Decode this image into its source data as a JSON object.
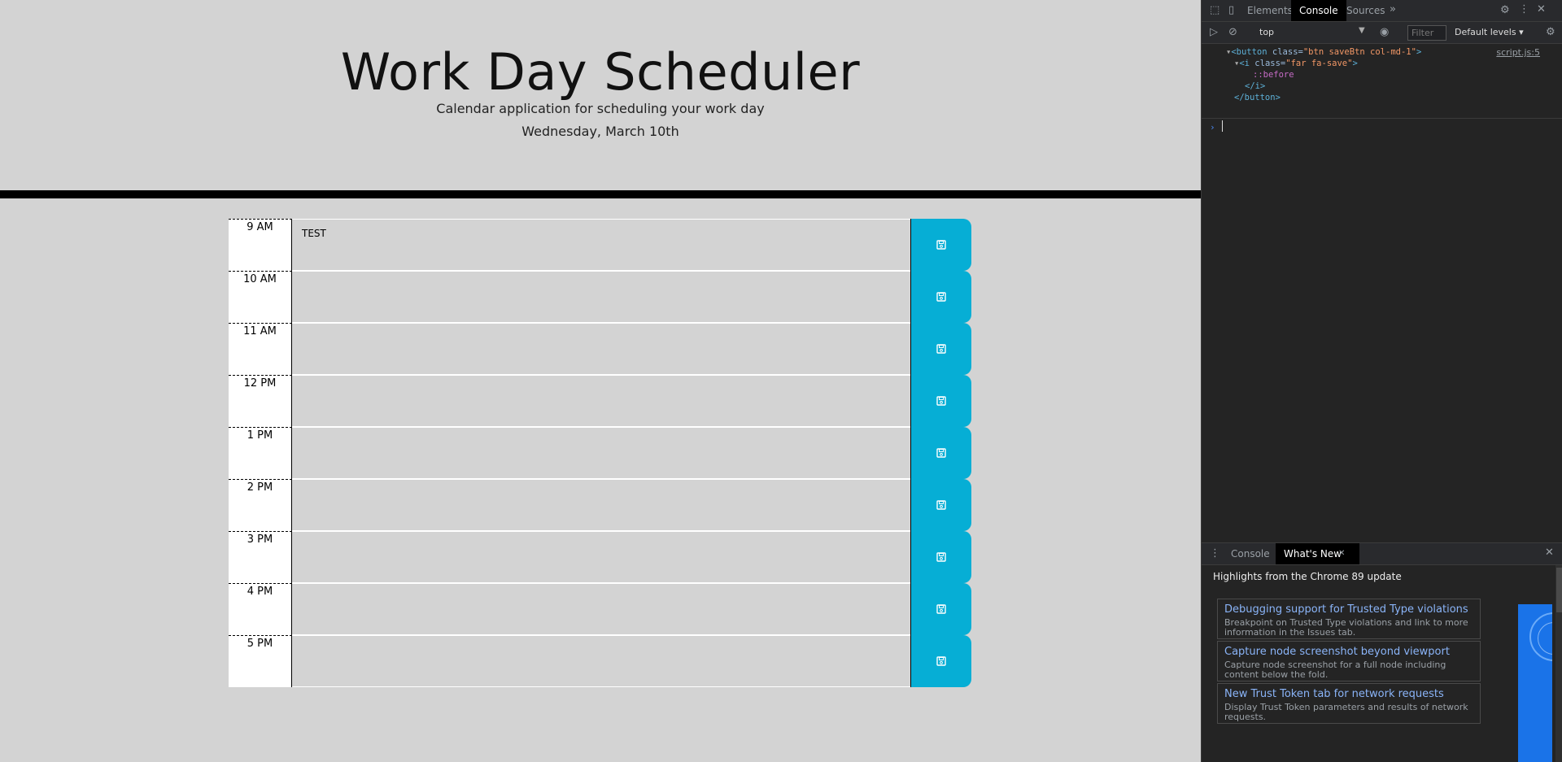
{
  "header": {
    "title": "Work Day Scheduler",
    "subtitle": "Calendar application for scheduling your work day",
    "date": "Wednesday, March 10th"
  },
  "schedule": {
    "rows": [
      {
        "hour": "9 AM",
        "text": "TEST"
      },
      {
        "hour": "10 AM",
        "text": ""
      },
      {
        "hour": "11 AM",
        "text": ""
      },
      {
        "hour": "12 PM",
        "text": ""
      },
      {
        "hour": "1 PM",
        "text": ""
      },
      {
        "hour": "2 PM",
        "text": ""
      },
      {
        "hour": "3 PM",
        "text": ""
      },
      {
        "hour": "4 PM",
        "text": ""
      },
      {
        "hour": "5 PM",
        "text": ""
      }
    ],
    "save_icon": "floppy-disk-icon"
  },
  "colors": {
    "page_bg": "#d3d3d3",
    "save_button": "#06aed5",
    "divider": "#000000",
    "hour_bg": "#ffffff"
  },
  "devtools": {
    "tabs": [
      "Elements",
      "Console",
      "Sources"
    ],
    "active_tab": "Console",
    "more_tabs": "»",
    "context": "top",
    "filter_placeholder": "Filter",
    "levels": "Default levels ▾",
    "output": {
      "line1_tag": "<button",
      "line1_attr": " class=",
      "line1_val": "\"btn saveBtn col-md-1\"",
      "line1_end": ">",
      "line2_tag": "<i",
      "line2_attr": " class=",
      "line2_val": "\"far fa-save\"",
      "line2_end": ">",
      "line3": "::before",
      "line4": "</i>",
      "line5": "</button>",
      "source": "script.js:5"
    },
    "drawer": {
      "tabs": [
        "Console",
        "What's New"
      ],
      "active_tab": "What's New",
      "heading": "Highlights from the Chrome 89 update",
      "cards": [
        {
          "title": "Debugging support for Trusted Type violations",
          "desc": "Breakpoint on Trusted Type violations and link to more information in the Issues tab."
        },
        {
          "title": "Capture node screenshot beyond viewport",
          "desc": "Capture node screenshot for a full node including content below the fold."
        },
        {
          "title": "New Trust Token tab for network requests",
          "desc": "Display Trust Token parameters and results of network requests."
        }
      ]
    }
  }
}
